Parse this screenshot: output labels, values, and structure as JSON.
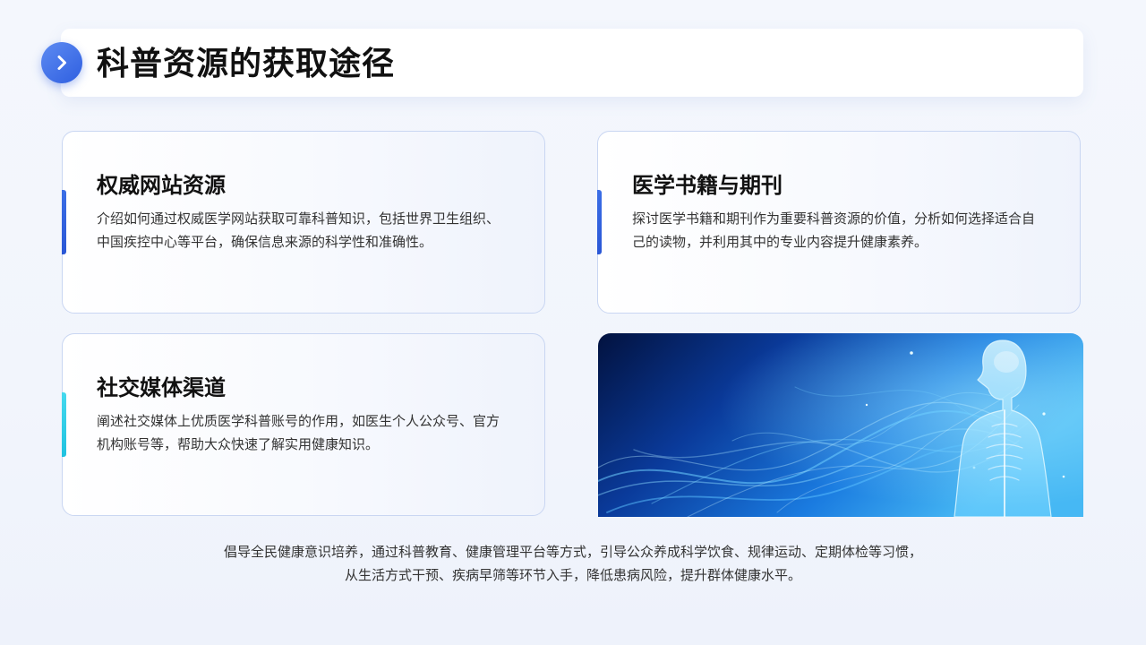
{
  "header": {
    "title": "科普资源的获取途径",
    "badge_icon": "chevron-right-icon",
    "accent_color": "#2f5fe0"
  },
  "cards": [
    {
      "title": "权威网站资源",
      "text": "介绍如何通过权威医学网站获取可靠科普知识，包括世界卫生组织、中国疾控中心等平台，确保信息来源的科学性和准确性。",
      "accent_color": "#2a57d6"
    },
    {
      "title": "医学书籍与期刊",
      "text": "探讨医学书籍和期刊作为重要科普资源的价值，分析如何选择适合自己的读物，并利用其中的专业内容提升健康素养。",
      "accent_color": "#2a57d6"
    },
    {
      "title": "社交媒体渠道",
      "text": "阐述社交媒体上优质医学科普账号的作用，如医生个人公众号、官方机构账号等，帮助大众快速了解实用健康知识。",
      "accent_color": "#1fc2e0"
    }
  ],
  "image": {
    "icon": "human-anatomy-illustration"
  },
  "footer": {
    "line1": "倡导全民健康意识培养，通过科普教育、健康管理平台等方式，引导公众养成科学饮食、规律运动、定期体检等习惯，",
    "line2": "从生活方式干预、疾病早筛等环节入手，降低患病风险，提升群体健康水平。"
  }
}
